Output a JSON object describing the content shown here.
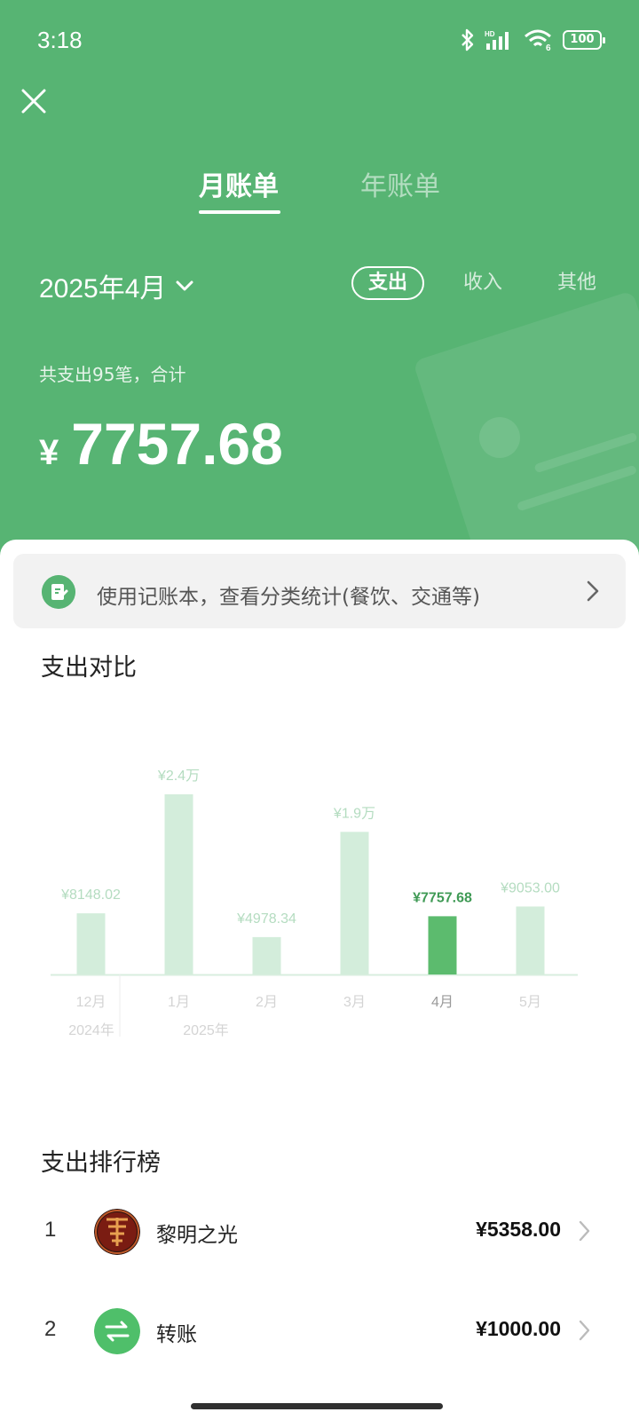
{
  "status": {
    "time": "3:18",
    "battery": "100"
  },
  "tabs": {
    "month": "月账单",
    "year": "年账单"
  },
  "period": {
    "label": "2025年4月"
  },
  "filters": {
    "expense": "支出",
    "income": "收入",
    "other": "其他"
  },
  "summary": {
    "text": "共支出95笔，合计",
    "currency": "¥",
    "total": "7757.68"
  },
  "promo": {
    "text": "使用记账本，查看分类统计(餐饮、交通等)"
  },
  "sections": {
    "compare": "支出对比",
    "ranking": "支出排行榜"
  },
  "colors": {
    "brand_green": "#57b473",
    "bar_light": "#d3eddb",
    "bar_active": "#5cbb6e"
  },
  "chart_data": {
    "type": "bar",
    "categories": [
      "12月",
      "1月",
      "2月",
      "3月",
      "4月",
      "5月"
    ],
    "year_groups": [
      {
        "label": "2024年",
        "categories": [
          "12月"
        ]
      },
      {
        "label": "2025年",
        "categories": [
          "1月",
          "2月",
          "3月",
          "4月",
          "5月"
        ]
      }
    ],
    "values": [
      8148.02,
      24000,
      4978.34,
      19000,
      7757.68,
      9053.0
    ],
    "value_labels": [
      "¥8148.02",
      "¥2.4万",
      "¥4978.34",
      "¥1.9万",
      "¥7757.68",
      "¥9053.00"
    ],
    "highlight_index": 4,
    "ylim": [
      0,
      24000
    ],
    "grid": false,
    "legend": "none"
  },
  "ranking": [
    {
      "rank": "1",
      "name": "黎明之光",
      "amount": "¥5358.00",
      "avatar": "dragon-avatar"
    },
    {
      "rank": "2",
      "name": "转账",
      "amount": "¥1000.00",
      "avatar": "transfer-icon"
    }
  ]
}
